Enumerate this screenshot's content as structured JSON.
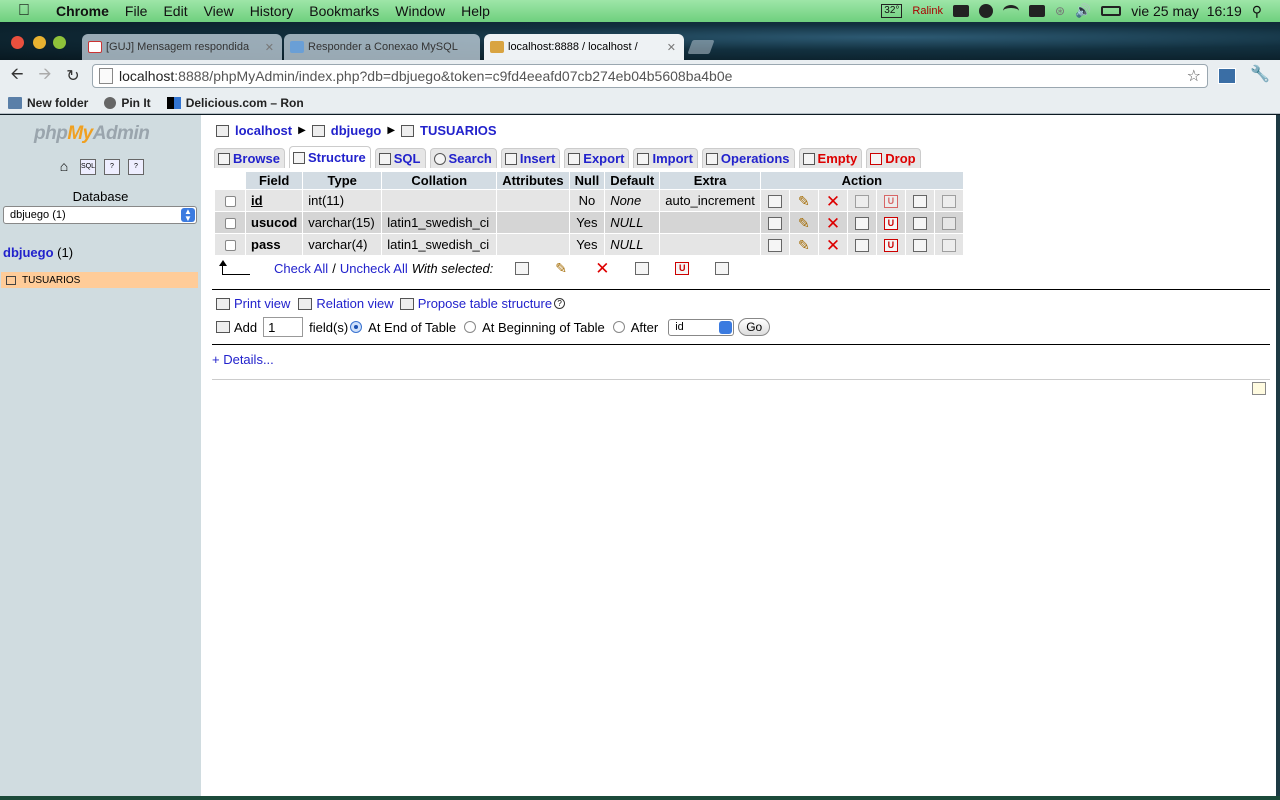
{
  "menubar": {
    "apple_icon": "apple-icon",
    "app_name": "Chrome",
    "menus": [
      "File",
      "Edit",
      "View",
      "History",
      "Bookmarks",
      "Window",
      "Help"
    ],
    "temperature": "32°",
    "ralink": "Ralink",
    "datetime": "vie 25 may  16:19"
  },
  "tabs": [
    {
      "title": "[GUJ] Mensagem respondida",
      "favicon": "gmail-icon",
      "active": false
    },
    {
      "title": "Responder a Conexao MySQL",
      "favicon": "forum-icon",
      "active": false
    },
    {
      "title": "localhost:8888 / localhost /",
      "favicon": "pma-icon",
      "active": true
    }
  ],
  "omnibox": {
    "host": "localhost",
    "rest": ":8888/phpMyAdmin/index.php?db=dbjuego&token=c9fd4eeafd07cb274eb04b5608ba4b0e"
  },
  "bookmarks": [
    {
      "label": "New folder",
      "icon": "folder-icon"
    },
    {
      "label": "Pin It",
      "icon": "pinterest-icon"
    },
    {
      "label": "Delicious.com – Ron",
      "icon": "delicious-icon"
    }
  ],
  "sidebar": {
    "logo_php": "php",
    "logo_my": "My",
    "logo_admin": "Admin",
    "database_label": "Database",
    "database_selected": "dbjuego (1)",
    "db_name": "dbjuego",
    "db_count": "(1)",
    "table_item": "TUSUARIOS"
  },
  "breadcrumb": {
    "server": "localhost",
    "database": "dbjuego",
    "table": "TUSUARIOS"
  },
  "pma_tabs": [
    {
      "label": "Browse",
      "active": false,
      "danger": false
    },
    {
      "label": "Structure",
      "active": true,
      "danger": false
    },
    {
      "label": "SQL",
      "active": false,
      "danger": false
    },
    {
      "label": "Search",
      "active": false,
      "danger": false
    },
    {
      "label": "Insert",
      "active": false,
      "danger": false
    },
    {
      "label": "Export",
      "active": false,
      "danger": false
    },
    {
      "label": "Import",
      "active": false,
      "danger": false
    },
    {
      "label": "Operations",
      "active": false,
      "danger": false
    },
    {
      "label": "Empty",
      "active": false,
      "danger": true
    },
    {
      "label": "Drop",
      "active": false,
      "danger": true
    }
  ],
  "structure_table": {
    "headers": [
      "Field",
      "Type",
      "Collation",
      "Attributes",
      "Null",
      "Default",
      "Extra",
      "Action"
    ],
    "rows": [
      {
        "field": "id",
        "type": "int(11)",
        "collation": "",
        "attributes": "",
        "null": "No",
        "default": "None",
        "extra": "auto_increment",
        "primary": true
      },
      {
        "field": "usucod",
        "type": "varchar(15)",
        "collation": "latin1_swedish_ci",
        "attributes": "",
        "null": "Yes",
        "default": "NULL",
        "extra": "",
        "primary": false
      },
      {
        "field": "pass",
        "type": "varchar(4)",
        "collation": "latin1_swedish_ci",
        "attributes": "",
        "null": "Yes",
        "default": "NULL",
        "extra": "",
        "primary": false
      }
    ]
  },
  "bulk": {
    "check_all": "Check All",
    "separator": "/",
    "uncheck_all": "Uncheck All",
    "with_selected": "With selected:"
  },
  "links": {
    "print_view": "Print view",
    "relation_view": "Relation view",
    "propose": "Propose table structure"
  },
  "add_fields": {
    "label": "Add",
    "count": "1",
    "fields_label": "field(s)",
    "at_end": "At End of Table",
    "at_beginning": "At Beginning of Table",
    "after": "After",
    "after_column": "id",
    "go": "Go"
  },
  "details": "+ Details..."
}
